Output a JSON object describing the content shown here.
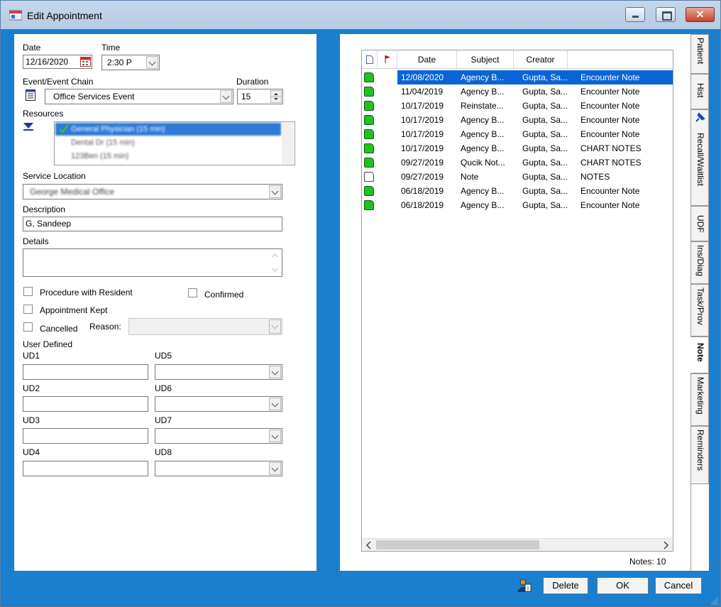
{
  "window": {
    "title": "Edit Appointment"
  },
  "form": {
    "date_label": "Date",
    "date_value": "12/16/2020",
    "time_label": "Time",
    "time_value": "2:30 P",
    "event_label": "Event/Event Chain",
    "event_value": "Office Services Event",
    "duration_label": "Duration",
    "duration_value": "15",
    "resources_label": "Resources",
    "resources": [
      {
        "label": "General Physician (15 min)",
        "selected": true
      },
      {
        "label": "Dental Dr (15 min)",
        "selected": false
      },
      {
        "label": "123Ben (15 min)",
        "selected": false
      }
    ],
    "service_location_label": "Service Location",
    "service_location_value": "George Medical Office",
    "description_label": "Description",
    "description_value": "G, Sandeep",
    "details_label": "Details",
    "details_value": "",
    "procedure_label": "Procedure with Resident",
    "confirmed_label": "Confirmed",
    "kept_label": "Appointment Kept",
    "cancelled_label": "Cancelled",
    "reason_label": "Reason:",
    "user_defined_label": "User Defined",
    "ud": {
      "ud1": "UD1",
      "ud2": "UD2",
      "ud3": "UD3",
      "ud4": "UD4",
      "ud5": "UD5",
      "ud6": "UD6",
      "ud7": "UD7",
      "ud8": "UD8"
    }
  },
  "notes": {
    "columns": {
      "date": "Date",
      "subject": "Subject",
      "creator": "Creator"
    },
    "rows": [
      {
        "date": "12/08/2020",
        "subject": "Agency B...",
        "creator": "Gupta, Sa...",
        "type": "Encounter Note",
        "icon": "note-green-icon"
      },
      {
        "date": "11/04/2019",
        "subject": "Agency B...",
        "creator": "Gupta, Sa...",
        "type": "Encounter Note",
        "icon": "note-green-icon"
      },
      {
        "date": "10/17/2019",
        "subject": "Reinstate...",
        "creator": "Gupta, Sa...",
        "type": "Encounter Note",
        "icon": "note-green-icon"
      },
      {
        "date": "10/17/2019",
        "subject": "Agency B...",
        "creator": "Gupta, Sa...",
        "type": "Encounter Note",
        "icon": "note-green-icon"
      },
      {
        "date": "10/17/2019",
        "subject": "Agency B...",
        "creator": "Gupta, Sa...",
        "type": "Encounter Note",
        "icon": "note-green-icon"
      },
      {
        "date": "10/17/2019",
        "subject": "Agency B...",
        "creator": "Gupta, Sa...",
        "type": "CHART NOTES",
        "icon": "note-green-icon"
      },
      {
        "date": "09/27/2019",
        "subject": "Qucik Not...",
        "creator": "Gupta, Sa...",
        "type": "CHART NOTES",
        "icon": "note-green-icon"
      },
      {
        "date": "09/27/2019",
        "subject": "Note",
        "creator": "Gupta, Sa...",
        "type": "NOTES",
        "icon": "note-edit-icon"
      },
      {
        "date": "06/18/2019",
        "subject": "Agency B...",
        "creator": "Gupta, Sa...",
        "type": "Encounter Note",
        "icon": "note-green-icon"
      },
      {
        "date": "06/18/2019",
        "subject": "Agency B...",
        "creator": "Gupta, Sa...",
        "type": "Encounter Note",
        "icon": "note-green-icon"
      }
    ],
    "count_text": "Notes: 10"
  },
  "tabs": [
    "Patient",
    "Hist",
    "Recall/Waitlist",
    "UDF",
    "Ins/Diag",
    "Task/Prov",
    "Note",
    "Marketing",
    "Reminders"
  ],
  "active_tab": "Note",
  "buttons": {
    "delete": "Delete",
    "ok": "OK",
    "cancel": "Cancel"
  },
  "colors": {
    "frame": "#1a7fcf",
    "selection": "#0a64d6",
    "note_green": "#22c122"
  }
}
